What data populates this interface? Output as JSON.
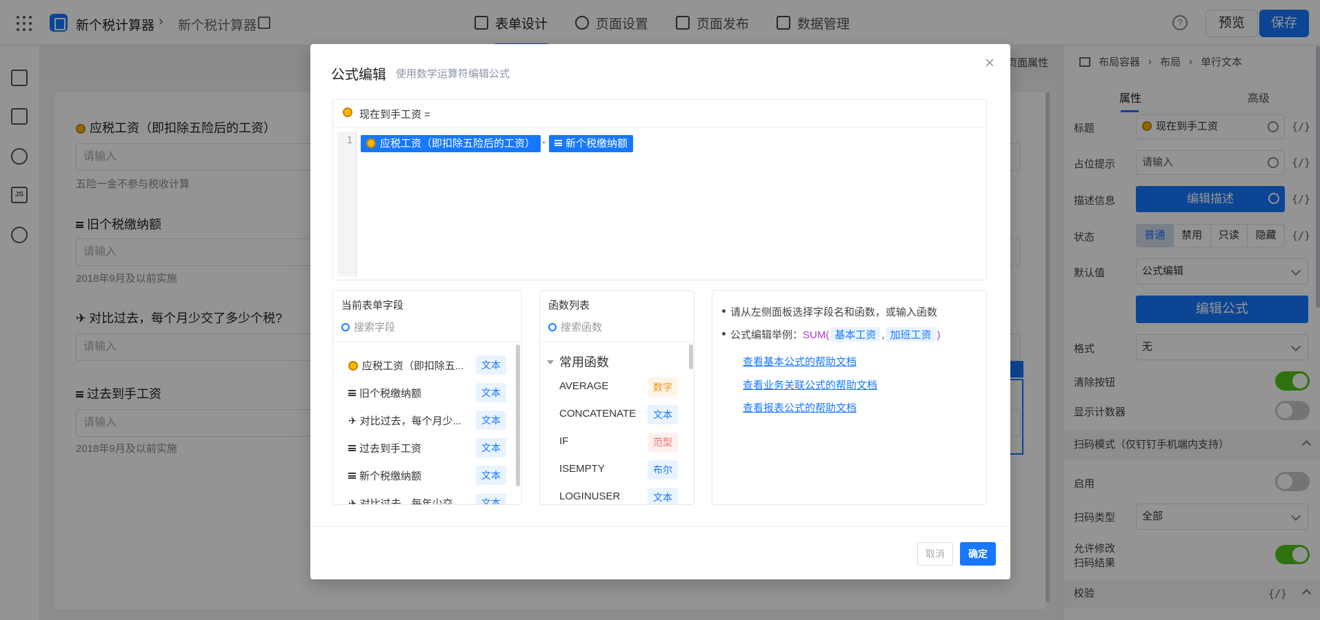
{
  "topbar": {
    "app_name": "新个税计算器",
    "form_name": "新个税计算器",
    "tabs": [
      {
        "label": "表单设计",
        "icon": "document-icon"
      },
      {
        "label": "页面设置",
        "icon": "gear-icon"
      },
      {
        "label": "页面发布",
        "icon": "send-icon"
      },
      {
        "label": "数据管理",
        "icon": "table-icon"
      }
    ],
    "preview_label": "预览",
    "save_label": "保存"
  },
  "canvas": {
    "page_props_label": "页面属性",
    "fields": [
      {
        "title": "应税工资（即扣除五险后的工资）",
        "icon": "sun-icon",
        "placeholder": "请输入",
        "desc": "五险一金不参与税收计算"
      },
      {
        "title": "旧个税缴纳额",
        "icon": "lines-icon",
        "placeholder": "请输入",
        "desc": "2018年9月及以前实施"
      },
      {
        "title": "对比过去，每个月少交了多少个税?",
        "icon": "plane-icon",
        "placeholder": "请输入",
        "desc": ""
      },
      {
        "title": "过去到手工资",
        "icon": "lines-icon",
        "placeholder": "请输入",
        "desc": "2018年9月及以前实施"
      }
    ]
  },
  "right_panel": {
    "breadcrumb": [
      "布局容器",
      "布局",
      "单行文本"
    ],
    "tabs": [
      "属性",
      "高级"
    ],
    "title_label": "标题",
    "title_value": "现在到手工资",
    "placeholder_label": "占位提示",
    "placeholder_value": "请输入",
    "desc_label": "描述信息",
    "desc_button": "编辑描述",
    "status_label": "状态",
    "status_options": [
      "普通",
      "禁用",
      "只读",
      "隐藏"
    ],
    "default_label": "默认值",
    "default_value": "公式编辑",
    "formula_button": "编辑公式",
    "format_label": "格式",
    "format_value": "无",
    "clear_label": "清除按钮",
    "counter_label": "显示计数器",
    "scan_section": "扫码模式（仅钉钉手机端内支持）",
    "enable_label": "启用",
    "scan_type_label": "扫码类型",
    "scan_type_value": "全部",
    "allow_edit_label_1": "允许修改",
    "allow_edit_label_2": "扫码结果",
    "validate_section": "校验",
    "code_symbol": "{/}"
  },
  "modal": {
    "title": "公式编辑",
    "subtitle": "使用数学运算符编辑公式",
    "target_field": "现在到手工资 =",
    "line_number": "1",
    "formula_chip_1": "应税工资（即扣除五险后的工资）",
    "formula_operator": "-",
    "formula_chip_2": "新个税缴纳额",
    "fields_panel": {
      "title": "当前表单字段",
      "search_placeholder": "搜索字段",
      "items": [
        {
          "label": "应税工资（即扣除五...",
          "icon": "sun-icon",
          "type": "文本"
        },
        {
          "label": "旧个税缴纳额",
          "icon": "lines-icon",
          "type": "文本"
        },
        {
          "label": "对比过去，每个月少...",
          "icon": "plane-icon",
          "type": "文本"
        },
        {
          "label": "过去到手工资",
          "icon": "lines-icon",
          "type": "文本"
        },
        {
          "label": "新个税缴纳额",
          "icon": "lines-icon",
          "type": "文本"
        },
        {
          "label": "对比过去，每年少交...",
          "icon": "plane-icon",
          "type": "文本"
        }
      ]
    },
    "funcs_panel": {
      "title": "函数列表",
      "search_placeholder": "搜索函数",
      "group": "常用函数",
      "items": [
        {
          "name": "AVERAGE",
          "type": "数字",
          "kind": "num"
        },
        {
          "name": "CONCATENATE",
          "type": "文本",
          "kind": "text"
        },
        {
          "name": "IF",
          "type": "范型",
          "kind": "range"
        },
        {
          "name": "ISEMPTY",
          "type": "布尔",
          "kind": "bool"
        },
        {
          "name": "LOGINUSER",
          "type": "文本",
          "kind": "text"
        }
      ]
    },
    "help": {
      "tip1": "请从左侧面板选择字段名和函数，或输入函数",
      "tip2_prefix": "公式编辑举例：",
      "tip2_func": "SUM(",
      "tip2_arg1": "基本工资",
      "tip2_comma": ",",
      "tip2_arg2": "加班工资",
      "tip2_close": ")",
      "links": [
        "查看基本公式的帮助文档",
        "查看业务关联公式的帮助文档",
        "查看报表公式的帮助文档"
      ]
    },
    "cancel_label": "取消",
    "ok_label": "确定"
  }
}
